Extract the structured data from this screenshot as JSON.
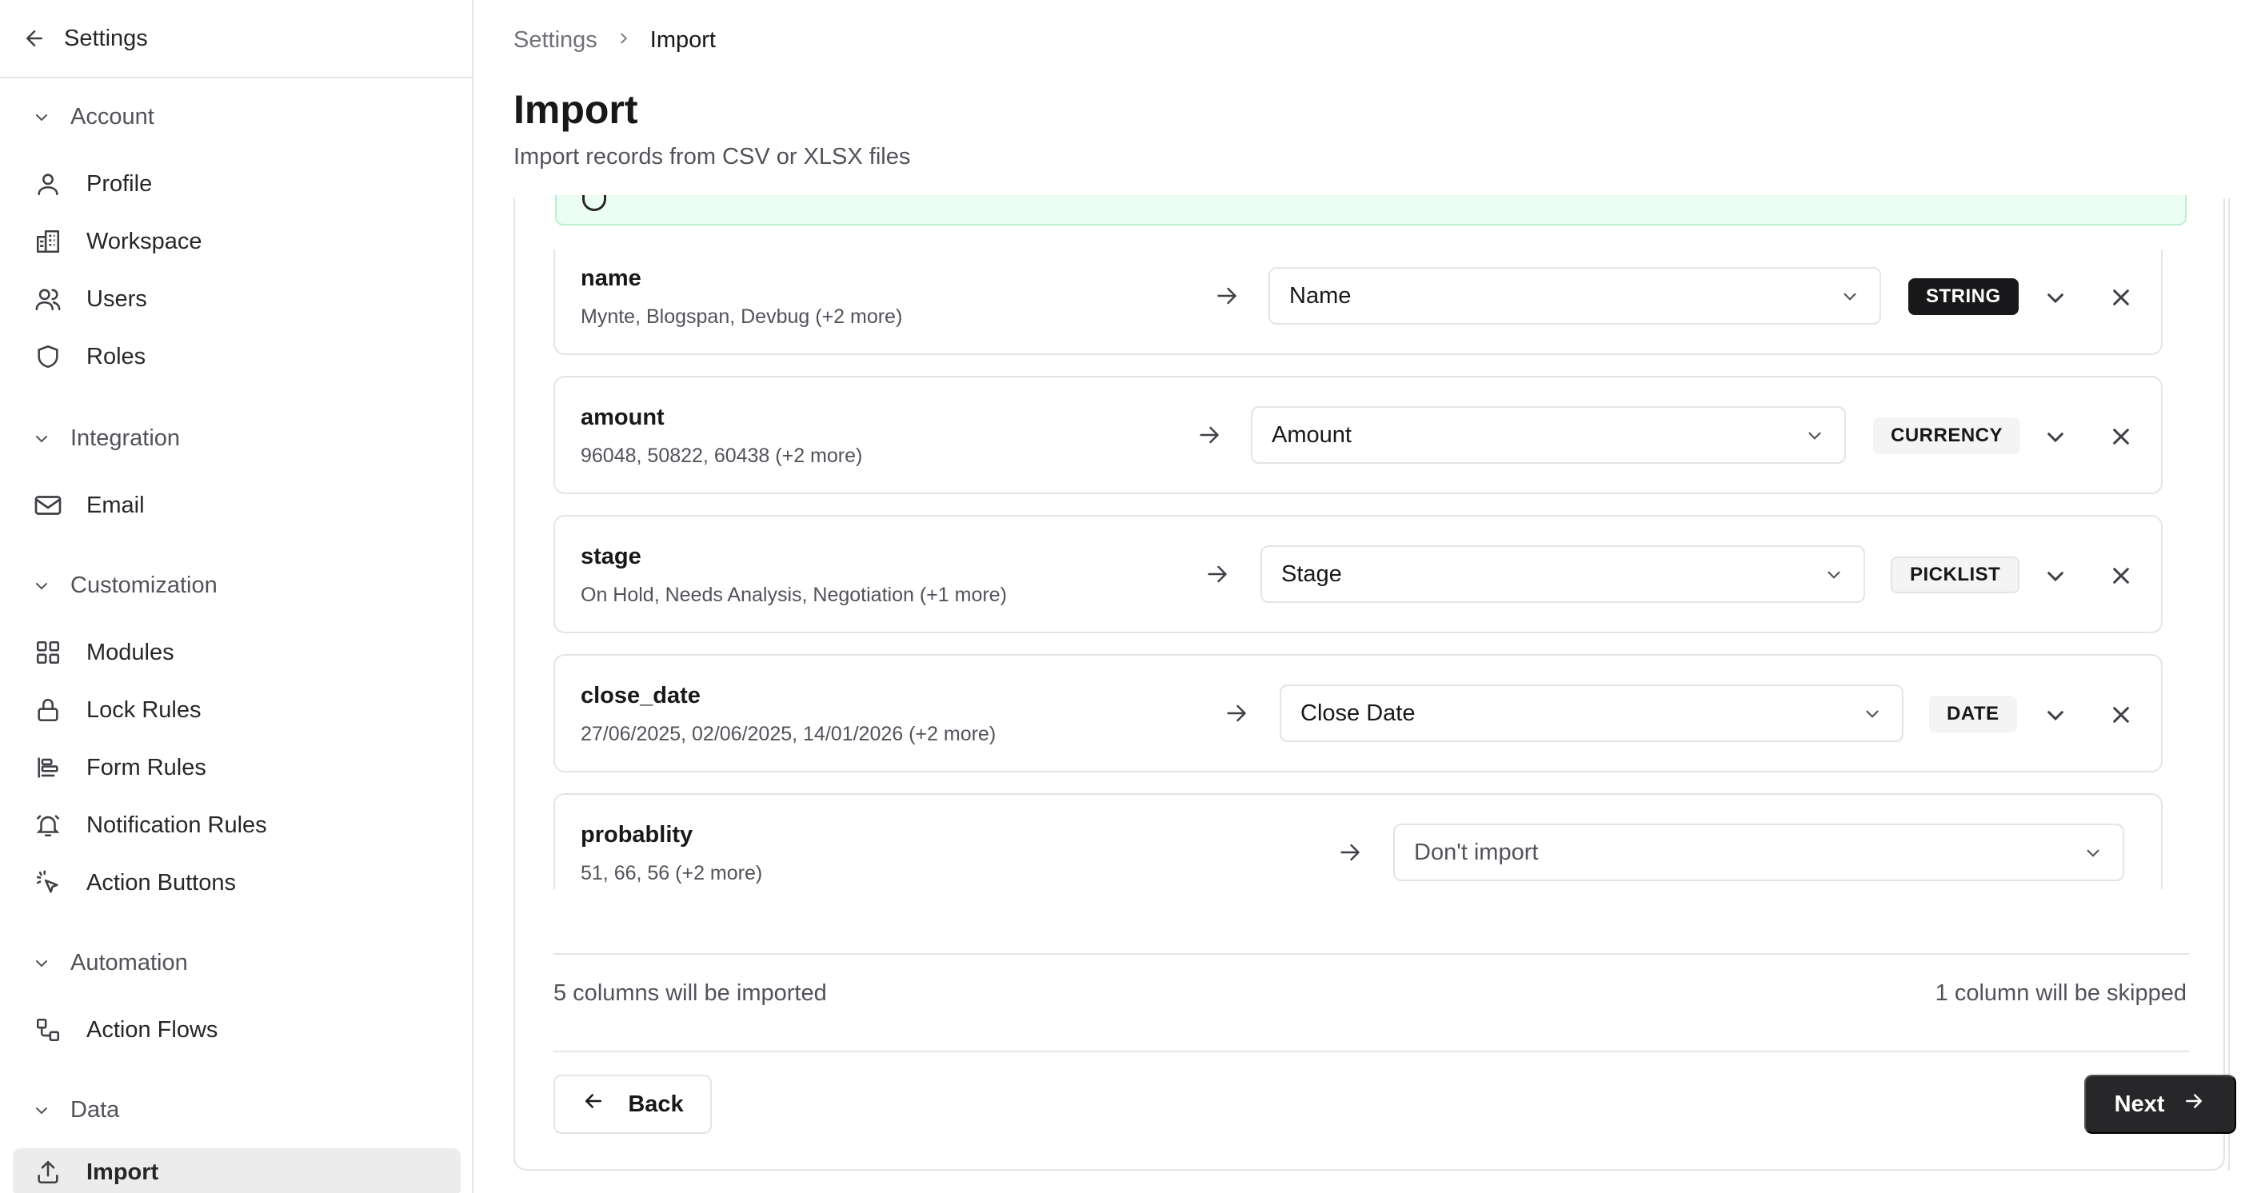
{
  "sidebar": {
    "back_label": "Settings",
    "groups": [
      {
        "label": "Account",
        "items": [
          {
            "label": "Profile",
            "icon": "user-icon"
          },
          {
            "label": "Workspace",
            "icon": "building-icon"
          },
          {
            "label": "Users",
            "icon": "users-icon"
          },
          {
            "label": "Roles",
            "icon": "shield-icon"
          }
        ]
      },
      {
        "label": "Integration",
        "items": [
          {
            "label": "Email",
            "icon": "mail-icon"
          }
        ]
      },
      {
        "label": "Customization",
        "items": [
          {
            "label": "Modules",
            "icon": "grid-icon"
          },
          {
            "label": "Lock Rules",
            "icon": "lock-icon"
          },
          {
            "label": "Form Rules",
            "icon": "align-left-icon"
          },
          {
            "label": "Notification Rules",
            "icon": "bell-icon"
          },
          {
            "label": "Action Buttons",
            "icon": "pointer-click-icon"
          }
        ]
      },
      {
        "label": "Automation",
        "items": [
          {
            "label": "Action Flows",
            "icon": "workflow-icon"
          }
        ]
      },
      {
        "label": "Data",
        "items": [
          {
            "label": "Import",
            "icon": "upload-icon",
            "active": true
          }
        ]
      }
    ]
  },
  "breadcrumb": {
    "parent": "Settings",
    "current": "Import"
  },
  "page": {
    "title": "Import",
    "subtitle": "Import records from CSV or XLSX files"
  },
  "mappings": [
    {
      "column": "name",
      "samples": "Mynte, Blogspan, Devbug (+2 more)",
      "field": "Name",
      "type": "STRING"
    },
    {
      "column": "amount",
      "samples": "96048, 50822, 60438 (+2 more)",
      "field": "Amount",
      "type": "CURRENCY"
    },
    {
      "column": "stage",
      "samples": "On Hold, Needs Analysis, Negotiation (+1 more)",
      "field": "Stage",
      "type": "PICKLIST"
    },
    {
      "column": "close_date",
      "samples": "27/06/2025, 02/06/2025, 14/01/2026 (+2 more)",
      "field": "Close Date",
      "type": "DATE"
    },
    {
      "column": "probablity",
      "samples": "51, 66, 56 (+2 more)",
      "field": "Don't import",
      "type": ""
    }
  ],
  "summary": {
    "imported": "5 columns will be imported",
    "skipped": "1 column will be skipped"
  },
  "actions": {
    "back_label": "Back",
    "next_label": "Next"
  },
  "colors": {
    "accent": "#27272a",
    "banner_bg": "#ecfdf3",
    "border": "#e4e4e7",
    "active_item_bg": "#ececed"
  }
}
